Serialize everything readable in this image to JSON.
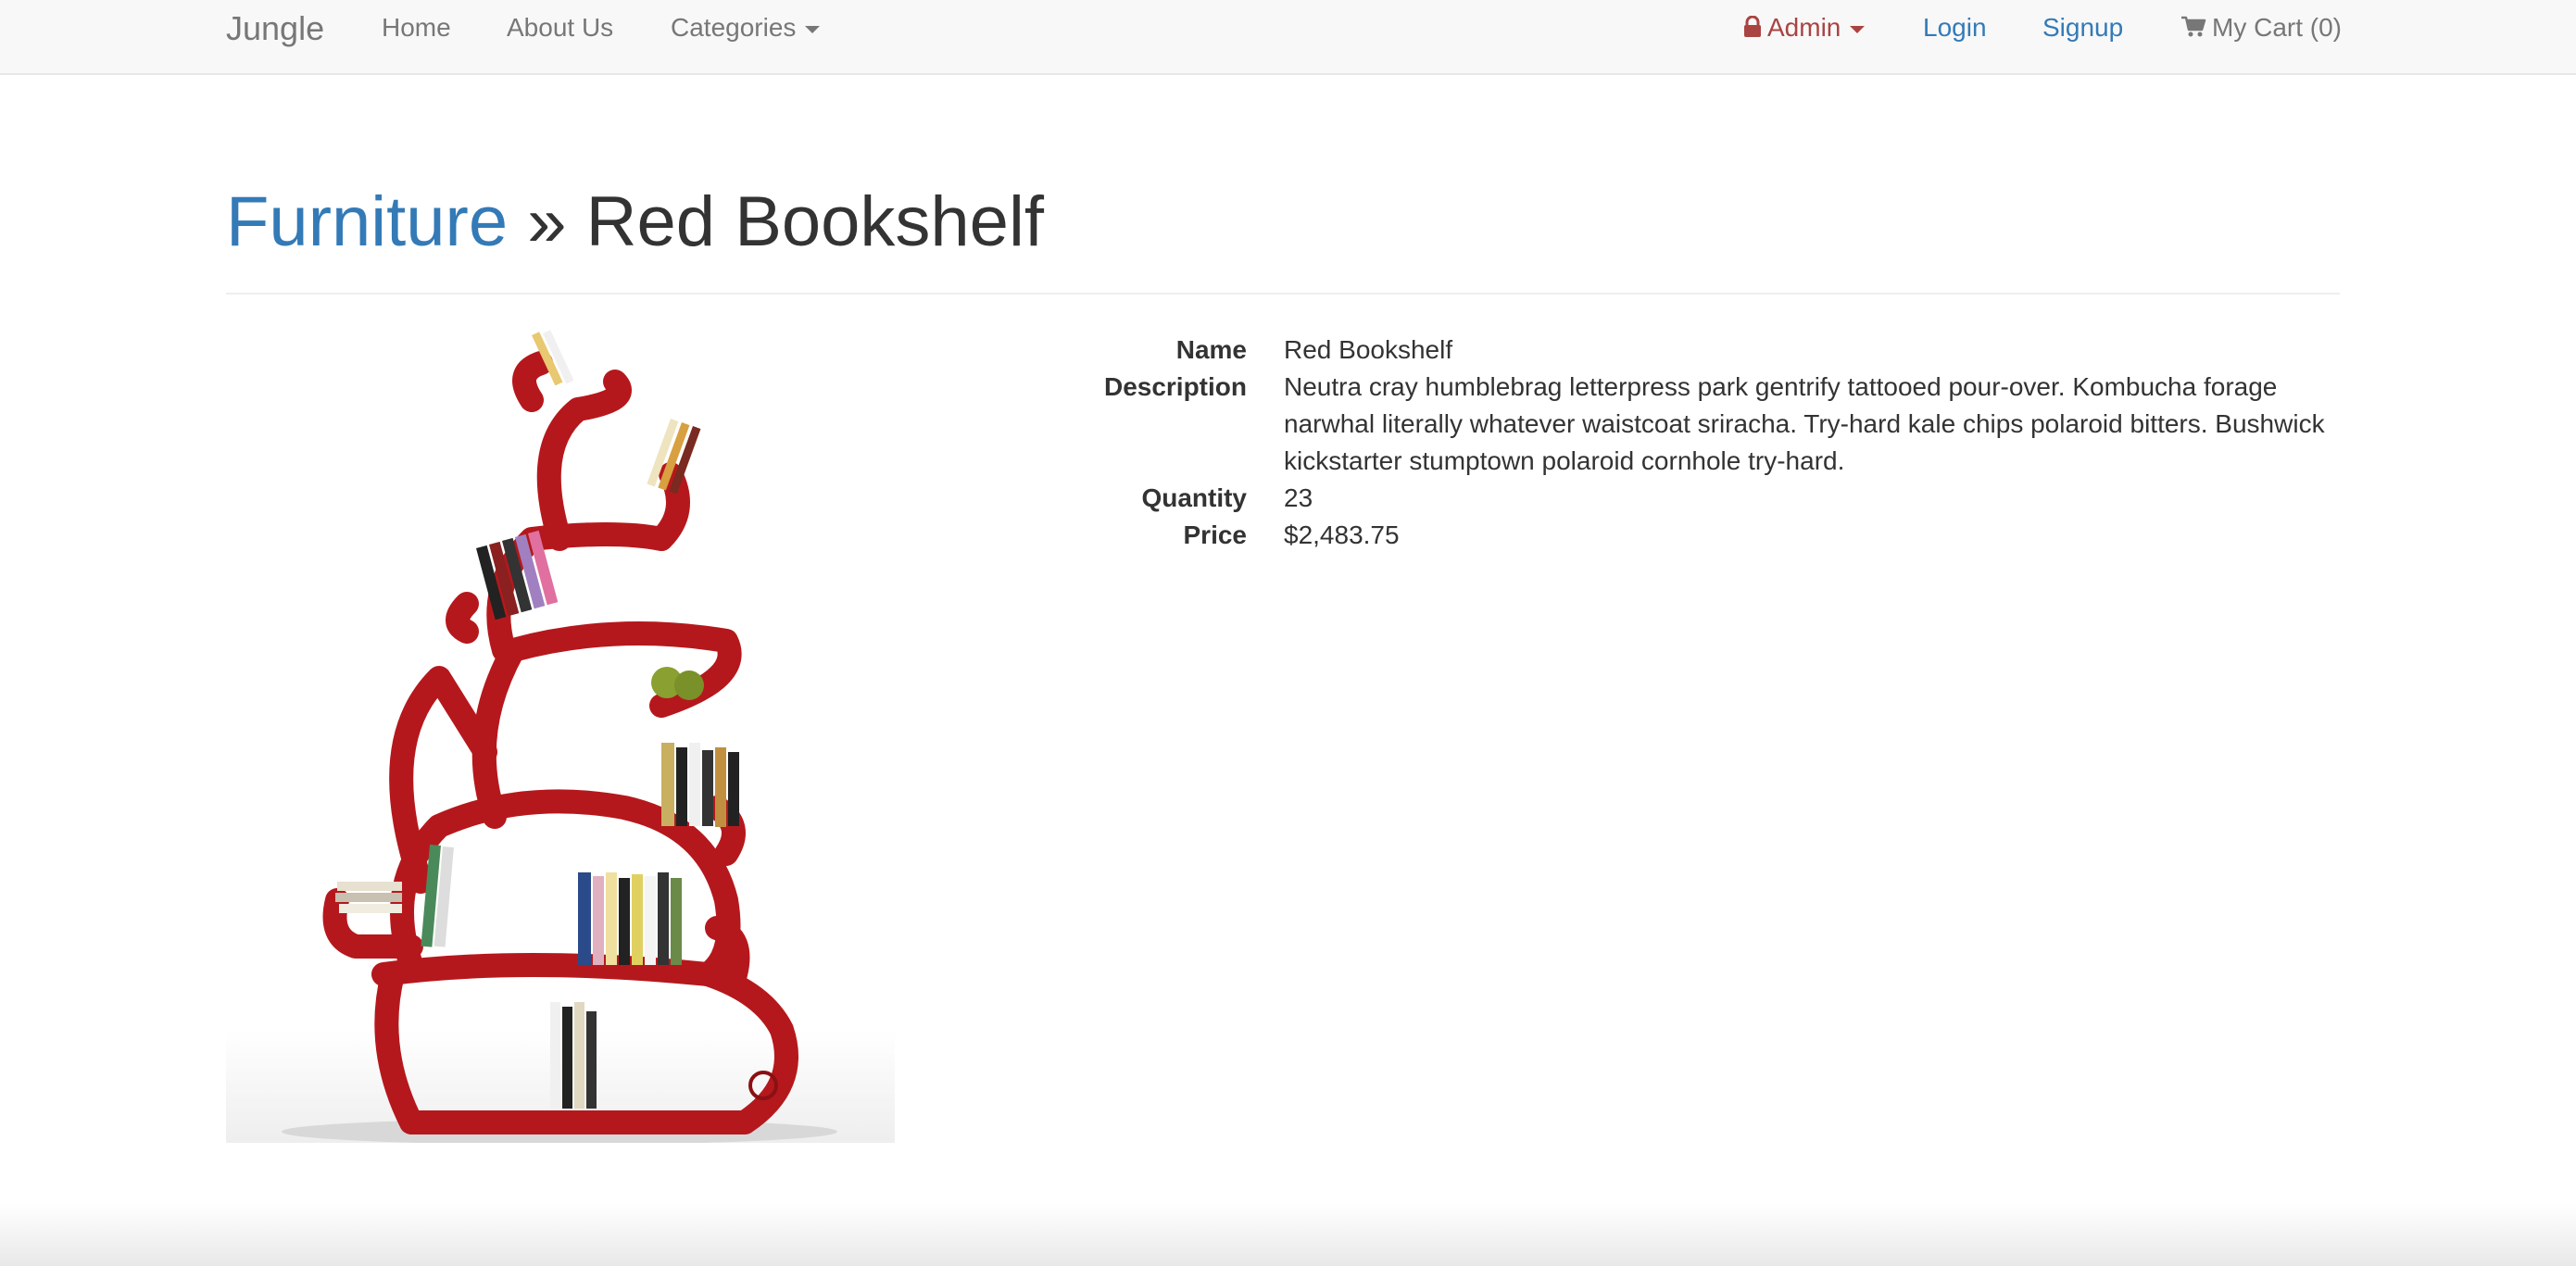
{
  "navbar": {
    "brand": "Jungle",
    "home": "Home",
    "about": "About Us",
    "categories": "Categories",
    "admin": "Admin",
    "login": "Login",
    "signup": "Signup",
    "cart": "My Cart (0)"
  },
  "header": {
    "category": "Furniture",
    "separator": "»",
    "title": "Red Bookshelf"
  },
  "product": {
    "labels": {
      "name": "Name",
      "description": "Description",
      "quantity": "Quantity",
      "price": "Price"
    },
    "name": "Red Bookshelf",
    "description": "Neutra cray humblebrag letterpress park gentrify tattooed pour-over. Kombucha forage narwhal literally whatever waistcoat sriracha. Try-hard kale chips polaroid bitters. Bushwick kickstarter stumptown polaroid cornhole try-hard.",
    "quantity": "23",
    "price": "$2,483.75"
  },
  "colors": {
    "link_blue": "#337ab7",
    "admin_red": "#a94442",
    "shelf_red": "#b5181c"
  }
}
